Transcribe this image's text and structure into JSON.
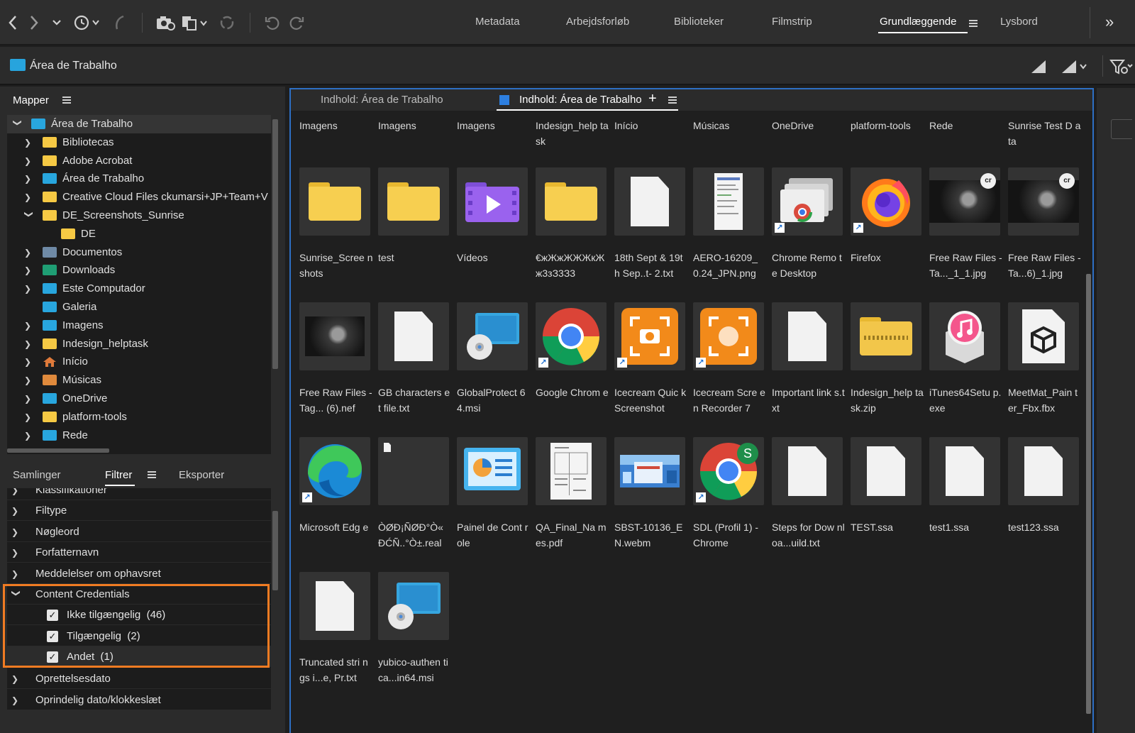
{
  "workspaces": [
    "Metadata",
    "Arbejdsforløb",
    "Biblioteker",
    "Filmstrip",
    "Grundlæggende",
    "Lysbord"
  ],
  "active_workspace": "Grundlæggende",
  "overflow_glyph": "»",
  "path": "Área de Trabalho",
  "folders_panel": {
    "title": "Mapper"
  },
  "tree": [
    {
      "label": "Área de Trabalho",
      "level": 0,
      "expanded": true,
      "icon": "blue"
    },
    {
      "label": "Bibliotecas",
      "level": 1,
      "expanded": false,
      "icon": "yellow"
    },
    {
      "label": "Adobe Acrobat",
      "level": 1,
      "expanded": false,
      "icon": "yellow"
    },
    {
      "label": "Área de Trabalho",
      "level": 1,
      "expanded": false,
      "icon": "blue"
    },
    {
      "label": "Creative Cloud Files  ckumarsi+JP+Team+V",
      "level": 1,
      "expanded": false,
      "icon": "yellow"
    },
    {
      "label": "DE_Screenshots_Sunrise",
      "level": 1,
      "expanded": true,
      "icon": "yellow"
    },
    {
      "label": "DE",
      "level": 2,
      "expanded": null,
      "icon": "yellow"
    },
    {
      "label": "Documentos",
      "level": 1,
      "expanded": false,
      "icon": "grey"
    },
    {
      "label": "Downloads",
      "level": 1,
      "expanded": false,
      "icon": "green"
    },
    {
      "label": "Este Computador",
      "level": 1,
      "expanded": false,
      "icon": "blue"
    },
    {
      "label": "Galeria",
      "level": 1,
      "expanded": null,
      "icon": "blue"
    },
    {
      "label": "Imagens",
      "level": 1,
      "expanded": false,
      "icon": "blue"
    },
    {
      "label": "Indesign_helptask",
      "level": 1,
      "expanded": false,
      "icon": "yellow"
    },
    {
      "label": "Início",
      "level": 1,
      "expanded": false,
      "icon": "home"
    },
    {
      "label": "Músicas",
      "level": 1,
      "expanded": false,
      "icon": "orange"
    },
    {
      "label": "OneDrive",
      "level": 1,
      "expanded": false,
      "icon": "blue"
    },
    {
      "label": "platform-tools",
      "level": 1,
      "expanded": false,
      "icon": "yellow"
    },
    {
      "label": "Rede",
      "level": 1,
      "expanded": false,
      "icon": "blue"
    }
  ],
  "lower_tabs": [
    "Samlinger",
    "Filtrer",
    "Eksporter"
  ],
  "active_lower_tab": "Filtrer",
  "filters": {
    "partial_top": "Klassifikationer",
    "groups": [
      "Filtype",
      "Nøgleord",
      "Forfatternavn",
      "Meddelelser om ophavsret"
    ],
    "content_credentials": {
      "label": "Content Credentials",
      "options": [
        {
          "label": "Ikke tilgængelig",
          "count": "(46)",
          "checked": true
        },
        {
          "label": "Tilgængelig",
          "count": "(2)",
          "checked": true
        },
        {
          "label": "Andet",
          "count": "(1)",
          "checked": true
        }
      ]
    },
    "groups_after": [
      "Oprettelsesdato",
      "Oprindelig dato/klokkeslæt"
    ]
  },
  "content": {
    "tabs": [
      "Indhold: Área de Trabalho",
      "Indhold: Área de Trabalho"
    ],
    "active_tab": 1,
    "add_glyph": "+"
  },
  "top_row_labels": [
    "Imagens",
    "Imagens",
    "Imagens",
    "Indesign_help task",
    "Início",
    "Músicas",
    "OneDrive",
    "platform-tools",
    "Rede",
    "Sunrise Test D ata"
  ],
  "items": [
    {
      "name": "Sunrise_Scree nshots",
      "icon": "folder",
      "shortcut": false
    },
    {
      "name": "test",
      "icon": "folder",
      "shortcut": false
    },
    {
      "name": "Vídeos",
      "icon": "video-folder",
      "shortcut": false
    },
    {
      "name": "€жЖжЖЖЖкЖж3зЗ3З3",
      "icon": "folder",
      "shortcut": false
    },
    {
      "name": "18th Sept & 19t h Sep..t- 2.txt",
      "icon": "doc",
      "shortcut": false
    },
    {
      "name": "AERO-16209_ 0.24_JPN.png",
      "icon": "screenshot",
      "shortcut": false
    },
    {
      "name": "Chrome Remo te Desktop",
      "icon": "remote-desktop",
      "shortcut": true
    },
    {
      "name": "Firefox",
      "icon": "firefox",
      "shortcut": true
    },
    {
      "name": "Free Raw Files - Ta..._1_1.jpg",
      "icon": "photo-cr",
      "shortcut": false
    },
    {
      "name": "Free Raw Files - Ta...6)_1.jpg",
      "icon": "photo-cr",
      "shortcut": false
    },
    {
      "name": "Free Raw Files - Tag... (6).nef",
      "icon": "photo",
      "shortcut": false
    },
    {
      "name": "GB characters et file.txt",
      "icon": "doc",
      "shortcut": false
    },
    {
      "name": "GlobalProtect 64.msi",
      "icon": "installer",
      "shortcut": false
    },
    {
      "name": "Google Chrom e",
      "icon": "chrome",
      "shortcut": true
    },
    {
      "name": "Icecream Quic k Screenshot",
      "icon": "icecream-screenshot",
      "shortcut": true
    },
    {
      "name": "Icecream Scre en Recorder 7",
      "icon": "icecream-recorder",
      "shortcut": true
    },
    {
      "name": "Important link s.txt",
      "icon": "doc",
      "shortcut": false
    },
    {
      "name": "Indesign_help task.zip",
      "icon": "zip-folder",
      "shortcut": false
    },
    {
      "name": "iTunes64Setu p.exe",
      "icon": "itunes",
      "shortcut": false
    },
    {
      "name": "MeetMat_Pain ter_Fbx.fbx",
      "icon": "3d-file",
      "shortcut": false
    },
    {
      "name": "Microsoft Edg e",
      "icon": "edge",
      "shortcut": true
    },
    {
      "name": "ÒØÐ¡ÑØÐ°Ò« ÐĆÑ..°Ò±.real",
      "icon": "tiny-doc",
      "shortcut": false
    },
    {
      "name": "Painel de Cont role",
      "icon": "control-panel",
      "shortcut": false
    },
    {
      "name": "QA_Final_Na mes.pdf",
      "icon": "pdf",
      "shortcut": false
    },
    {
      "name": "SBST-10136_E N.webm",
      "icon": "video-thumb",
      "shortcut": false
    },
    {
      "name": "SDL (Profil 1) - Chrome",
      "icon": "chrome-profile",
      "shortcut": true
    },
    {
      "name": "Steps for Dow nloa...uild.txt",
      "icon": "doc",
      "shortcut": false
    },
    {
      "name": "TEST.ssa",
      "icon": "doc",
      "shortcut": false
    },
    {
      "name": "test1.ssa",
      "icon": "doc",
      "shortcut": false
    },
    {
      "name": "test123.ssa",
      "icon": "doc",
      "shortcut": false
    },
    {
      "name": "Truncated stri ngs i...e, Pr.txt",
      "icon": "doc",
      "shortcut": false
    },
    {
      "name": "yubico-authen tica...in64.msi",
      "icon": "installer",
      "shortcut": false
    }
  ],
  "badges": {
    "cr": "cr",
    "profile_letter": "S",
    "shortcut_glyph": "↗"
  },
  "colors": {
    "accent": "#2d6fc4",
    "highlight": "#f07b22",
    "folder": "#f7cf50"
  }
}
